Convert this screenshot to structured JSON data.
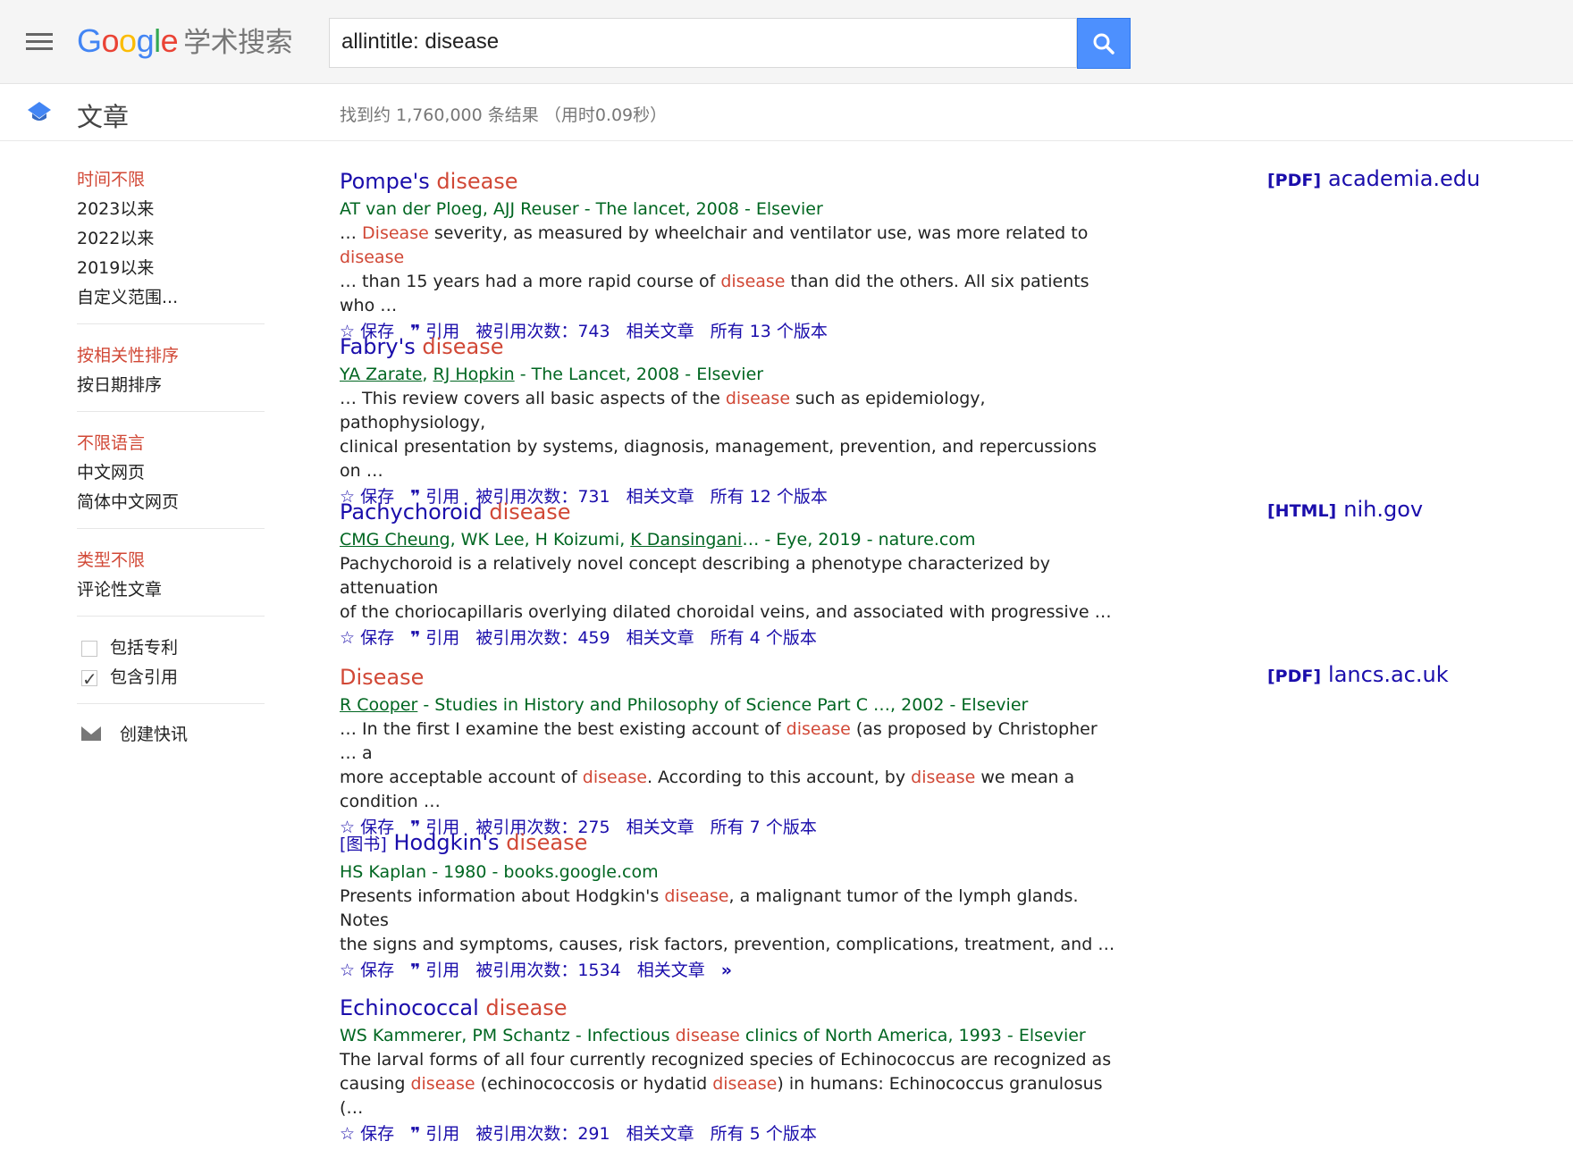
{
  "header": {
    "logo_google": [
      "G",
      "o",
      "o",
      "g",
      "l",
      "e"
    ],
    "logo_scholar": "学术搜索",
    "search_value": "allintitle: disease"
  },
  "subbar": {
    "section": "文章",
    "stats": "找到约 1,760,000 条结果 （用时0.09秒）"
  },
  "sidebar": {
    "time": [
      "时间不限",
      "2023以来",
      "2022以来",
      "2019以来",
      "自定义范围..."
    ],
    "sort": [
      "按相关性排序",
      "按日期排序"
    ],
    "lang": [
      "不限语言",
      "中文网页",
      "简体中文网页"
    ],
    "type": [
      "类型不限",
      "评论性文章"
    ],
    "checks": [
      {
        "label": "包括专利",
        "checked": false
      },
      {
        "label": "包含引用",
        "checked": true
      }
    ],
    "alert": "创建快讯"
  },
  "actions": {
    "save": "保存",
    "cite": "引用",
    "cited_prefix": "被引用次数：",
    "related": "相关文章",
    "versions_prefix": "所有",
    "versions_suffix": "个版本"
  },
  "results": [
    {
      "title_plain": "Pompe's ",
      "title_hl": "disease",
      "authors": "AT van der Ploeg, AJJ Reuser - The lancet, 2008 - Elsevier",
      "snippet_html": "… <span class=\"hl\">Disease</span> severity, as measured by wheelchair and ventilator use, was more related to <span class=\"hl\">disease</span> <br>… than 15 years had a more rapid course of <span class=\"hl\">disease</span> than did the others. All six patients who …",
      "cited": "743",
      "versions": "13",
      "source": {
        "type": "[PDF]",
        "domain": "academia.edu"
      }
    },
    {
      "title_plain": "Fabry's ",
      "title_hl": "disease",
      "authors_html": "<span class=\"link\">YA Zarate</span>, <span class=\"link\">RJ Hopkin</span> - The Lancet, 2008 - Elsevier",
      "snippet_html": "… This review covers all basic aspects of the <span class=\"hl\">disease</span> such as epidemiology, pathophysiology, <br>clinical presentation by systems, diagnosis, management, prevention, and repercussions on …",
      "cited": "731",
      "versions": "12"
    },
    {
      "title_plain": "Pachychoroid ",
      "title_hl": "disease",
      "authors_html": "<span class=\"link\">CMG Cheung</span>, WK Lee, H Koizumi, <span class=\"link\">K Dansingani</span>… - Eye, 2019 - nature.com",
      "snippet_html": "Pachychoroid is a relatively novel concept describing a phenotype characterized by attenuation <br>of the choriocapillaris overlying dilated choroidal veins, and associated with progressive …",
      "cited": "459",
      "versions": "4",
      "source": {
        "type": "[HTML]",
        "domain": "nih.gov"
      }
    },
    {
      "title_plain": "",
      "title_hl": "Disease",
      "authors_html": "<span class=\"link\">R Cooper</span> - Studies in History and Philosophy of Science Part C …, 2002 - Elsevier",
      "snippet_html": "… In the first I examine the best existing account of <span class=\"hl\">disease</span> (as proposed by Christopher … a <br>more acceptable account of <span class=\"hl\">disease</span>. According to this account, by <span class=\"hl\">disease</span> we mean a condition …",
      "cited": "275",
      "versions": "7",
      "source": {
        "type": "[PDF]",
        "domain": "lancs.ac.uk"
      }
    },
    {
      "tag": "[图书]",
      "title_plain": "Hodgkin's ",
      "title_hl": "disease",
      "authors": "HS Kaplan - 1980 - books.google.com",
      "snippet_html": "Presents information about Hodgkin's <span class=\"hl\">disease</span>, a malignant tumor of the lymph glands. Notes <br>the signs and symptoms, causes, risk factors, prevention, complications, treatment, and …",
      "cited": "1534",
      "more_icon": true
    },
    {
      "title_plain": "Echinococcal ",
      "title_hl": "disease",
      "authors_html": "WS Kammerer, PM Schantz - Infectious <span class=\"hl\">disease</span> clinics of North America, 1993 - Elsevier",
      "snippet_html": "The larval forms of all four currently recognized species of Echinococcus are recognized as <br>causing <span class=\"hl\">disease</span> (echinococcosis or hydatid <span class=\"hl\">disease</span>) in humans: Echinococcus granulosus (…",
      "cited": "291",
      "versions": "5"
    }
  ]
}
